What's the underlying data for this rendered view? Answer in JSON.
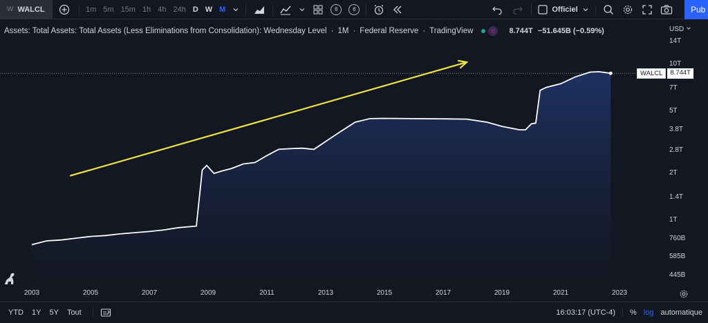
{
  "toolbar": {
    "symbol_prefix": "W",
    "symbol": "WALCL",
    "intervals": [
      "1m",
      "5m",
      "15m",
      "1h",
      "4h",
      "24h",
      "D",
      "W",
      "M"
    ],
    "active_interval": "M",
    "indicator_count_a": "6",
    "indicator_count_b": "6",
    "layout_label": "Officiel",
    "publish_label": "Pub"
  },
  "legend": {
    "title": "Assets: Total Assets: Total Assets (Less Eliminations from Consolidation): Wednesday Level",
    "interval": "1M",
    "source": "Federal Reserve",
    "platform": "TradingView",
    "badge": "E",
    "last_value": "8.744T",
    "change": "−51.645B (−0.59%)"
  },
  "price_axis": {
    "currency": "USD",
    "ticks": [
      {
        "label": "14T",
        "value": 14000
      },
      {
        "label": "10T",
        "value": 10000
      },
      {
        "label": "7T",
        "value": 7000
      },
      {
        "label": "5T",
        "value": 5000
      },
      {
        "label": "3.8T",
        "value": 3800
      },
      {
        "label": "2.8T",
        "value": 2800
      },
      {
        "label": "2T",
        "value": 2000
      },
      {
        "label": "1.4T",
        "value": 1400
      },
      {
        "label": "1T",
        "value": 1000
      },
      {
        "label": "760B",
        "value": 760
      },
      {
        "label": "585B",
        "value": 585
      },
      {
        "label": "445B",
        "value": 445
      }
    ]
  },
  "price_tag": {
    "name": "WALCL",
    "value": "8.744T"
  },
  "bottom_bar": {
    "ranges": [
      "YTD",
      "1Y",
      "5Y",
      "Tout"
    ],
    "clock": "16:03:17 (UTC-4)",
    "percent": "%",
    "log": "log",
    "auto": "automatique"
  },
  "colors": {
    "line": "#ffffff",
    "fill_top": "#1e3366",
    "fill_bottom": "#131722",
    "arrow": "#f0e442",
    "accent": "#2962ff"
  },
  "chart_data": {
    "type": "area",
    "title": "Assets: Total Assets: Total Assets (Less Eliminations from Consolidation): Wednesday Level",
    "xlabel": "",
    "ylabel": "",
    "scale": "log",
    "units": "billions USD",
    "x_ticks": [
      "2003",
      "2005",
      "2007",
      "2009",
      "2011",
      "2013",
      "2015",
      "2017",
      "2019",
      "2021",
      "2023"
    ],
    "ylim": [
      445,
      14000
    ],
    "series": [
      {
        "x": [
          2003.0,
          2003.5,
          2004.0,
          2004.5,
          2005.0,
          2005.5,
          2006.0,
          2006.5,
          2007.0,
          2007.5,
          2008.0,
          2008.6,
          2008.8,
          2008.95,
          2009.2,
          2009.5,
          2009.8,
          2010.2,
          2010.6,
          2011.0,
          2011.4,
          2011.8,
          2012.2,
          2012.6,
          2013.0,
          2013.5,
          2014.0,
          2014.5,
          2015.0,
          2016.0,
          2017.0,
          2017.8,
          2018.5,
          2019.0,
          2019.6,
          2019.8,
          2020.0,
          2020.15,
          2020.3,
          2020.5,
          2021.0,
          2021.5,
          2022.0,
          2022.3,
          2022.7
        ],
        "y": [
          700,
          740,
          750,
          770,
          790,
          800,
          820,
          835,
          850,
          870,
          900,
          920,
          2100,
          2250,
          2000,
          2080,
          2150,
          2300,
          2350,
          2600,
          2850,
          2880,
          2900,
          2850,
          3200,
          3700,
          4250,
          4480,
          4500,
          4480,
          4470,
          4450,
          4250,
          4000,
          3800,
          3800,
          4150,
          4200,
          6800,
          7100,
          7500,
          8300,
          8900,
          8950,
          8744
        ]
      }
    ],
    "annotations": [
      {
        "type": "arrow",
        "from": {
          "x": 2004.3,
          "y": 1930
        },
        "to": {
          "x": 2017.8,
          "y": 10300
        }
      }
    ],
    "last_value_line": 8744,
    "grid": false
  }
}
